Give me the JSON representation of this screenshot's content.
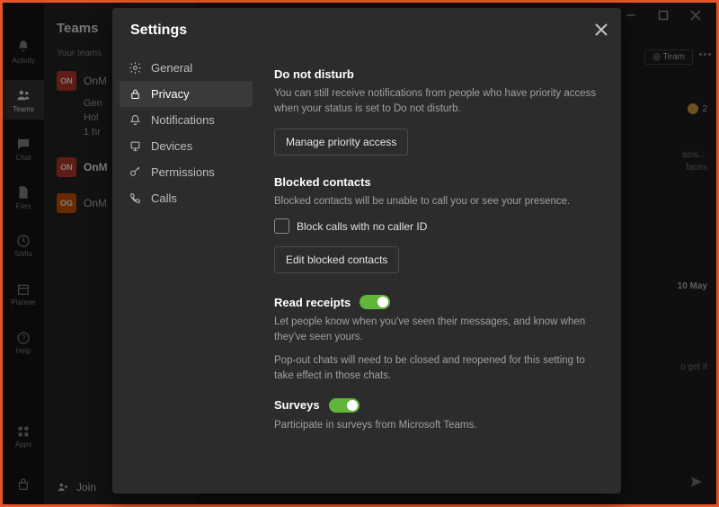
{
  "window": {
    "title": "Settings"
  },
  "rail": {
    "items": [
      {
        "key": "activity",
        "label": "Activity"
      },
      {
        "key": "teams",
        "label": "Teams"
      },
      {
        "key": "chat",
        "label": "Chat"
      },
      {
        "key": "files",
        "label": "Files"
      },
      {
        "key": "shifts",
        "label": "Shifts"
      },
      {
        "key": "planner",
        "label": "Planner"
      },
      {
        "key": "help",
        "label": "Help"
      }
    ],
    "bottom": {
      "apps": "Apps"
    }
  },
  "channels": {
    "header": "Teams",
    "sub": "Your teams",
    "rows": [
      {
        "badge": "ON",
        "color": "#c0392b",
        "label": "OnM"
      },
      {
        "sublabel": "Gen"
      },
      {
        "sublabel": "Hol",
        "muted": true
      },
      {
        "sublabel": "1 hr",
        "muted": true
      },
      {
        "badge": "ON",
        "color": "#c0392b",
        "label": "OnM",
        "bold": true
      },
      {
        "badge": "OG",
        "color": "#d35400",
        "label": "OnM"
      }
    ],
    "join": "Join"
  },
  "rightpane": {
    "team_button": "Team",
    "badge_count": "2",
    "line1a": "acis…",
    "line1b": "faces",
    "date": "10 May",
    "line2": "o get it"
  },
  "settings": {
    "title": "Settings",
    "nav": [
      {
        "key": "general",
        "label": "General"
      },
      {
        "key": "privacy",
        "label": "Privacy"
      },
      {
        "key": "notifications",
        "label": "Notifications"
      },
      {
        "key": "devices",
        "label": "Devices"
      },
      {
        "key": "permissions",
        "label": "Permissions"
      },
      {
        "key": "calls",
        "label": "Calls"
      }
    ],
    "privacy": {
      "dnd_heading": "Do not disturb",
      "dnd_desc": "You can still receive notifications from people who have priority access when your status is set to Do not disturb.",
      "manage_btn": "Manage priority access",
      "blocked_heading": "Blocked contacts",
      "blocked_desc": "Blocked contacts will be unable to call you or see your presence.",
      "block_nocaller": "Block calls with no caller ID",
      "edit_blocked_btn": "Edit blocked contacts",
      "read_heading": "Read receipts",
      "read_desc1": "Let people know when you've seen their messages, and know when they've seen yours.",
      "read_desc2": "Pop-out chats will need to be closed and reopened for this setting to take effect in those chats.",
      "surveys_heading": "Surveys",
      "surveys_desc": "Participate in surveys from Microsoft Teams."
    }
  }
}
